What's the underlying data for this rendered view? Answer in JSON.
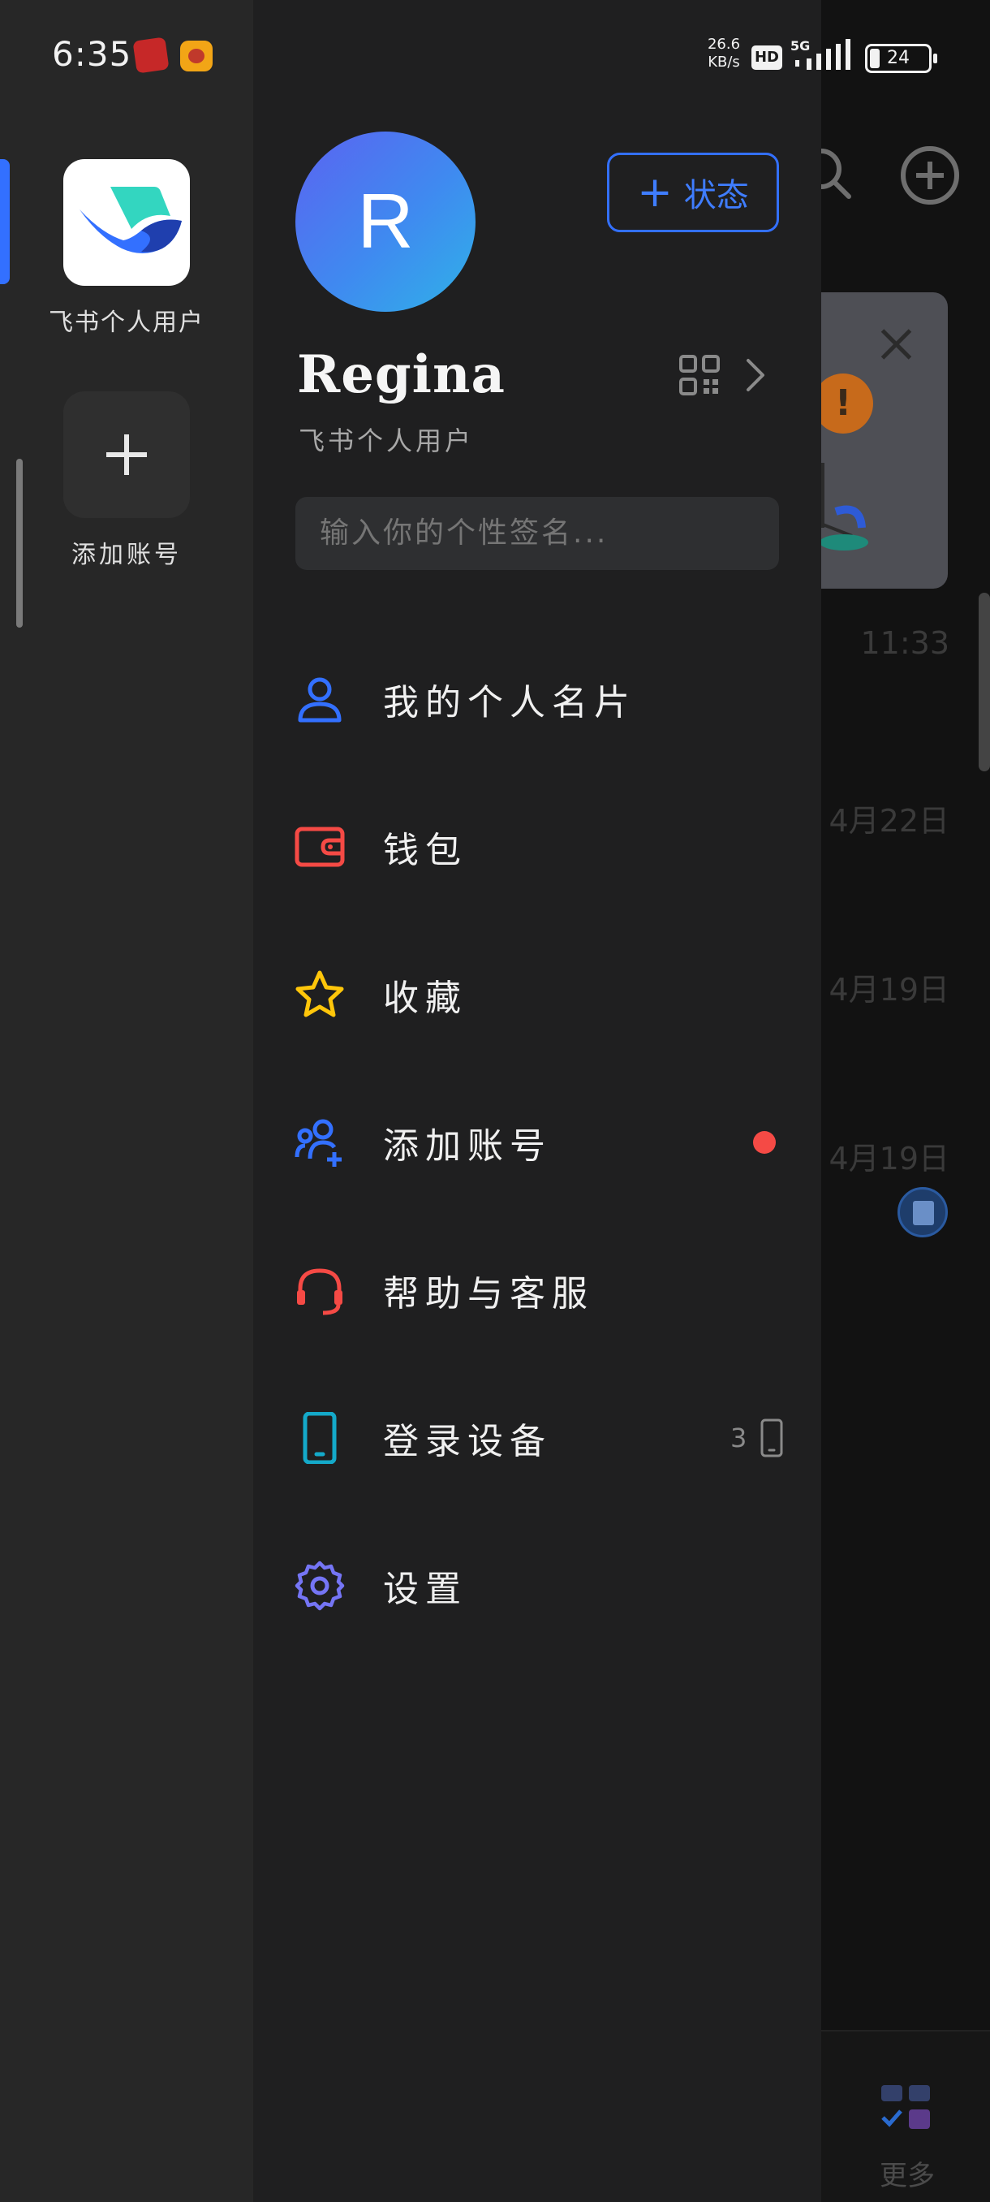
{
  "status_bar": {
    "time": "6:35",
    "net_speed_value": "26.6",
    "net_speed_unit": "KB/s",
    "hd": "HD",
    "network": "5G",
    "battery": "24"
  },
  "account_rail": {
    "accounts": [
      {
        "label": "飞书个人用户",
        "active": true
      }
    ],
    "add_label": "添加账号"
  },
  "profile": {
    "avatar_letter": "R",
    "status_button": "状态",
    "name": "Regina",
    "subtitle": "飞书个人用户",
    "signature_placeholder": "输入你的个性签名..."
  },
  "menu": [
    {
      "id": "card",
      "label": "我的个人名片",
      "icon": "person-icon",
      "color": "#3370ff"
    },
    {
      "id": "wallet",
      "label": "钱包",
      "icon": "wallet-icon",
      "color": "#f54a45"
    },
    {
      "id": "favorites",
      "label": "收藏",
      "icon": "star-icon",
      "color": "#ffc60a"
    },
    {
      "id": "add-account",
      "label": "添加账号",
      "icon": "add-user-icon",
      "color": "#3370ff",
      "badge": "red-dot"
    },
    {
      "id": "help",
      "label": "帮助与客服",
      "icon": "headset-icon",
      "color": "#f54a45"
    },
    {
      "id": "devices",
      "label": "登录设备",
      "icon": "phone-icon",
      "color": "#14a9c9",
      "count": "3"
    },
    {
      "id": "settings",
      "label": "设置",
      "icon": "gear-icon",
      "color": "#7575f5"
    }
  ],
  "background_app": {
    "times": [
      "11:33",
      "4月22日",
      "4月19日",
      "4月19日"
    ],
    "tab_more": "更多"
  },
  "colors": {
    "accent": "#3370ff",
    "drawer_bg": "#1f1f20",
    "rail_bg": "#272727"
  }
}
